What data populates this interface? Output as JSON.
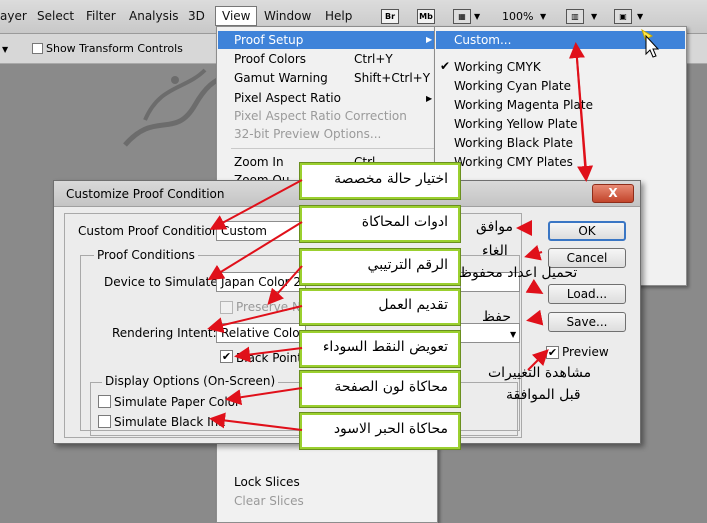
{
  "menubar": {
    "items": [
      "ayer",
      "Select",
      "Filter",
      "Analysis",
      "3D",
      "View",
      "Window",
      "Help"
    ],
    "icons": [
      "Br",
      "Mb"
    ],
    "zoom": "100%"
  },
  "options_bar": {
    "show_transform_controls": "Show Transform Controls"
  },
  "view_menu": {
    "items": [
      {
        "label": "Proof Setup",
        "shortcut": ""
      },
      {
        "label": "Proof Colors",
        "shortcut": "Ctrl+Y"
      },
      {
        "label": "Gamut Warning",
        "shortcut": "Shift+Ctrl+Y"
      },
      {
        "label": "Pixel Aspect Ratio",
        "shortcut": ""
      },
      {
        "label": "Pixel Aspect Ratio Correction",
        "shortcut": ""
      },
      {
        "label": "32-bit Preview Options...",
        "shortcut": ""
      },
      {
        "label": "Zoom In",
        "shortcut": "Ctrl"
      },
      {
        "label": "Zoom Ou",
        "shortcut": ""
      },
      {
        "label": "Lock Slices",
        "shortcut": ""
      },
      {
        "label": "Clear Slices",
        "shortcut": ""
      }
    ]
  },
  "proof_submenu": {
    "items": [
      "Custom...",
      "Working CMYK",
      "Working Cyan Plate",
      "Working Magenta Plate",
      "Working Yellow Plate",
      "Working Black Plate",
      "Working CMY Plates"
    ]
  },
  "dialog": {
    "title": "Customize Proof Condition",
    "close": "X",
    "custom_label": "Custom Proof Condition:",
    "custom_value": "Custom",
    "proof_conditions": "Proof Conditions",
    "device_label": "Device to Simulate:",
    "device_value": "Japan Color 20",
    "preserve_label": "Preserve Nu",
    "intent_label": "Rendering Intent:",
    "intent_value": "Relative Colori",
    "black_point_label": "Black Point C",
    "display_options": "Display Options (On-Screen)",
    "paper_color_label": "Simulate Paper Color",
    "black_ink_label": "Simulate Black Ink",
    "ok": "OK",
    "cancel": "Cancel",
    "load": "Load...",
    "save": "Save...",
    "preview": "Preview"
  },
  "annotations": {
    "callouts": [
      "اختيار حالة مخصصة",
      "ادوات المحاكاة",
      "الرقم الترتيبي",
      "تقديم العمل",
      "تعويض النقط السوداء",
      "محاكاة لون الصفحة",
      "محاكاة الحبر الاسود"
    ],
    "ok_note": "موافق",
    "cancel_note": "الغاء",
    "load_note": "تحميل اعداد محفوظ",
    "save_note": "حفظ",
    "preview_note_1": "مشاهدة التغييرات",
    "preview_note_2": "قبل الموافقة"
  },
  "colors": {
    "highlight": "#3f83d9",
    "callout_border": "#9bd02f",
    "arrow": "#e0101a"
  }
}
